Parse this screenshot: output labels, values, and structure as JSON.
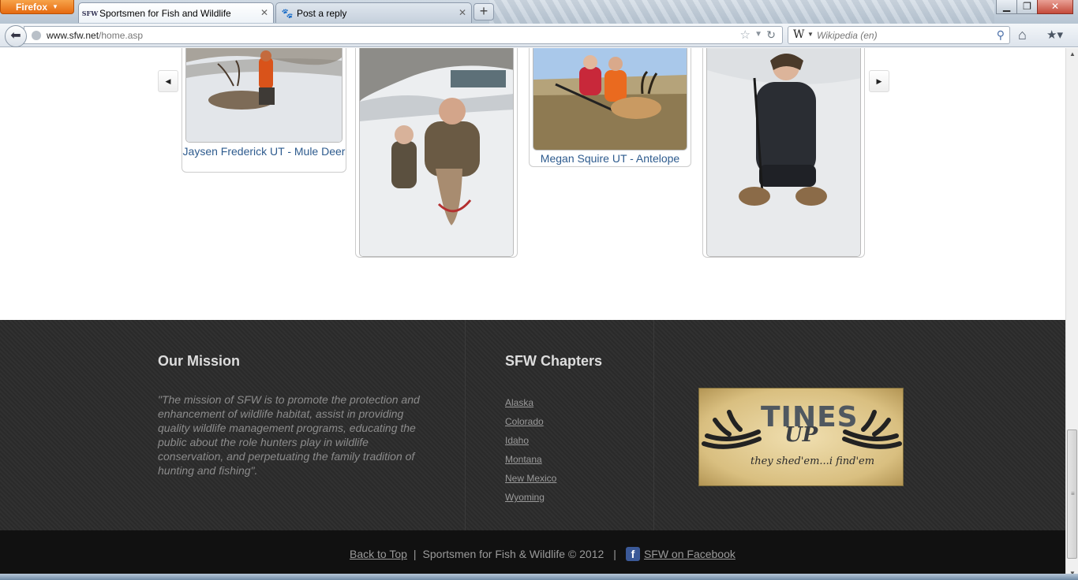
{
  "browser": {
    "menu_button": "Firefox",
    "tabs": [
      {
        "favicon": "SFW",
        "title": "Sportsmen for Fish and Wildlife",
        "active": true
      },
      {
        "favicon": "paw-icon",
        "title": "Post a reply",
        "active": false
      }
    ],
    "new_tab": "+",
    "url_host": "www.sfw.net",
    "url_path": "/home.asp",
    "search_engine_icon": "W",
    "search_placeholder": "Wikipedia (en)"
  },
  "carousel": {
    "prev": "◀",
    "next": "▶",
    "slides": [
      {
        "caption": "Jaysen Frederick UT - Mule Deer"
      },
      {
        "caption": ""
      },
      {
        "caption": "Megan Squire UT - Antelope"
      },
      {
        "caption": ""
      }
    ]
  },
  "footer": {
    "mission_title": "Our Mission",
    "mission_text": "\"The mission of SFW is to promote the protection and enhancement of wildlife habitat, assist in providing quality wildlife management programs, educating the public about the role hunters play in wildlife conservation, and perpetuating the family tradition of hunting and fishing\".",
    "chapters_title": "SFW Chapters",
    "chapters": [
      "Alaska",
      "Colorado",
      "Idaho",
      "Montana",
      "New Mexico",
      "Wyoming"
    ],
    "ad": {
      "brand_top": "TINES",
      "brand_bottom": "UP",
      "tagline": "they shed'em...i find'em"
    },
    "bottom": {
      "back_to_top": "Back to Top",
      "sep": "|",
      "copyright": "Sportsmen for Fish & Wildlife © 2012",
      "facebook": "SFW on Facebook"
    }
  },
  "colors": {
    "link_blue": "#2e5b8e",
    "footer_bg": "#2a2a2a",
    "firefox_orange": "#e66a10",
    "facebook_blue": "#3b5998"
  }
}
